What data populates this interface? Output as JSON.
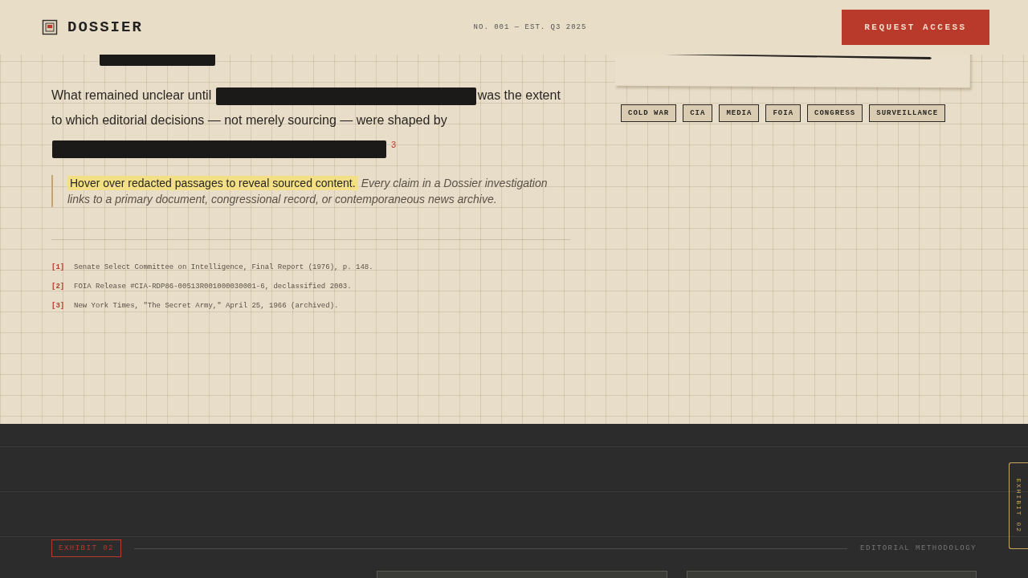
{
  "header": {
    "brand": "DOSSIER",
    "issue": "NO. 001 — EST. Q3 2025",
    "cta": "REQUEST ACCESS"
  },
  "article": {
    "paragraphs": [
      [
        {
          "kind": "redaction"
        }
      ],
      [
        {
          "kind": "text",
          "text": "What remained unclear until"
        },
        {
          "kind": "redaction"
        },
        {
          "kind": "text",
          "text": "was the extent to which editorial decisions — not merely sourcing — were shaped by"
        },
        {
          "kind": "redaction"
        },
        {
          "kind": "footnote",
          "text": "3"
        }
      ]
    ],
    "callout": {
      "highlight": "Hover over redacted passages to reveal sourced content.",
      "note": "Every claim in a Dossier investigation links to a primary document, congressional record, or contemporaneous news archive."
    },
    "footnotes": [
      {
        "mark": "[1]",
        "text": "Senate Select Committee on Intelligence, Final Report (1976), p. 148."
      },
      {
        "mark": "[2]",
        "text": "FOIA Release #CIA-RDP86-00513R001000030001-6, declassified 2003."
      },
      {
        "mark": "[3]",
        "text": "New York Times, \"The Secret Army,\" April 25, 1966 (archived)."
      }
    ]
  },
  "tags": [
    "COLD WAR",
    "CIA",
    "MEDIA",
    "FOIA",
    "CONGRESS",
    "SURVEILLANCE"
  ],
  "exhibit": {
    "label": "EXHIBIT 02",
    "section": "EDITORIAL METHODOLOGY",
    "side_tab": "EXHIBIT 02"
  }
}
